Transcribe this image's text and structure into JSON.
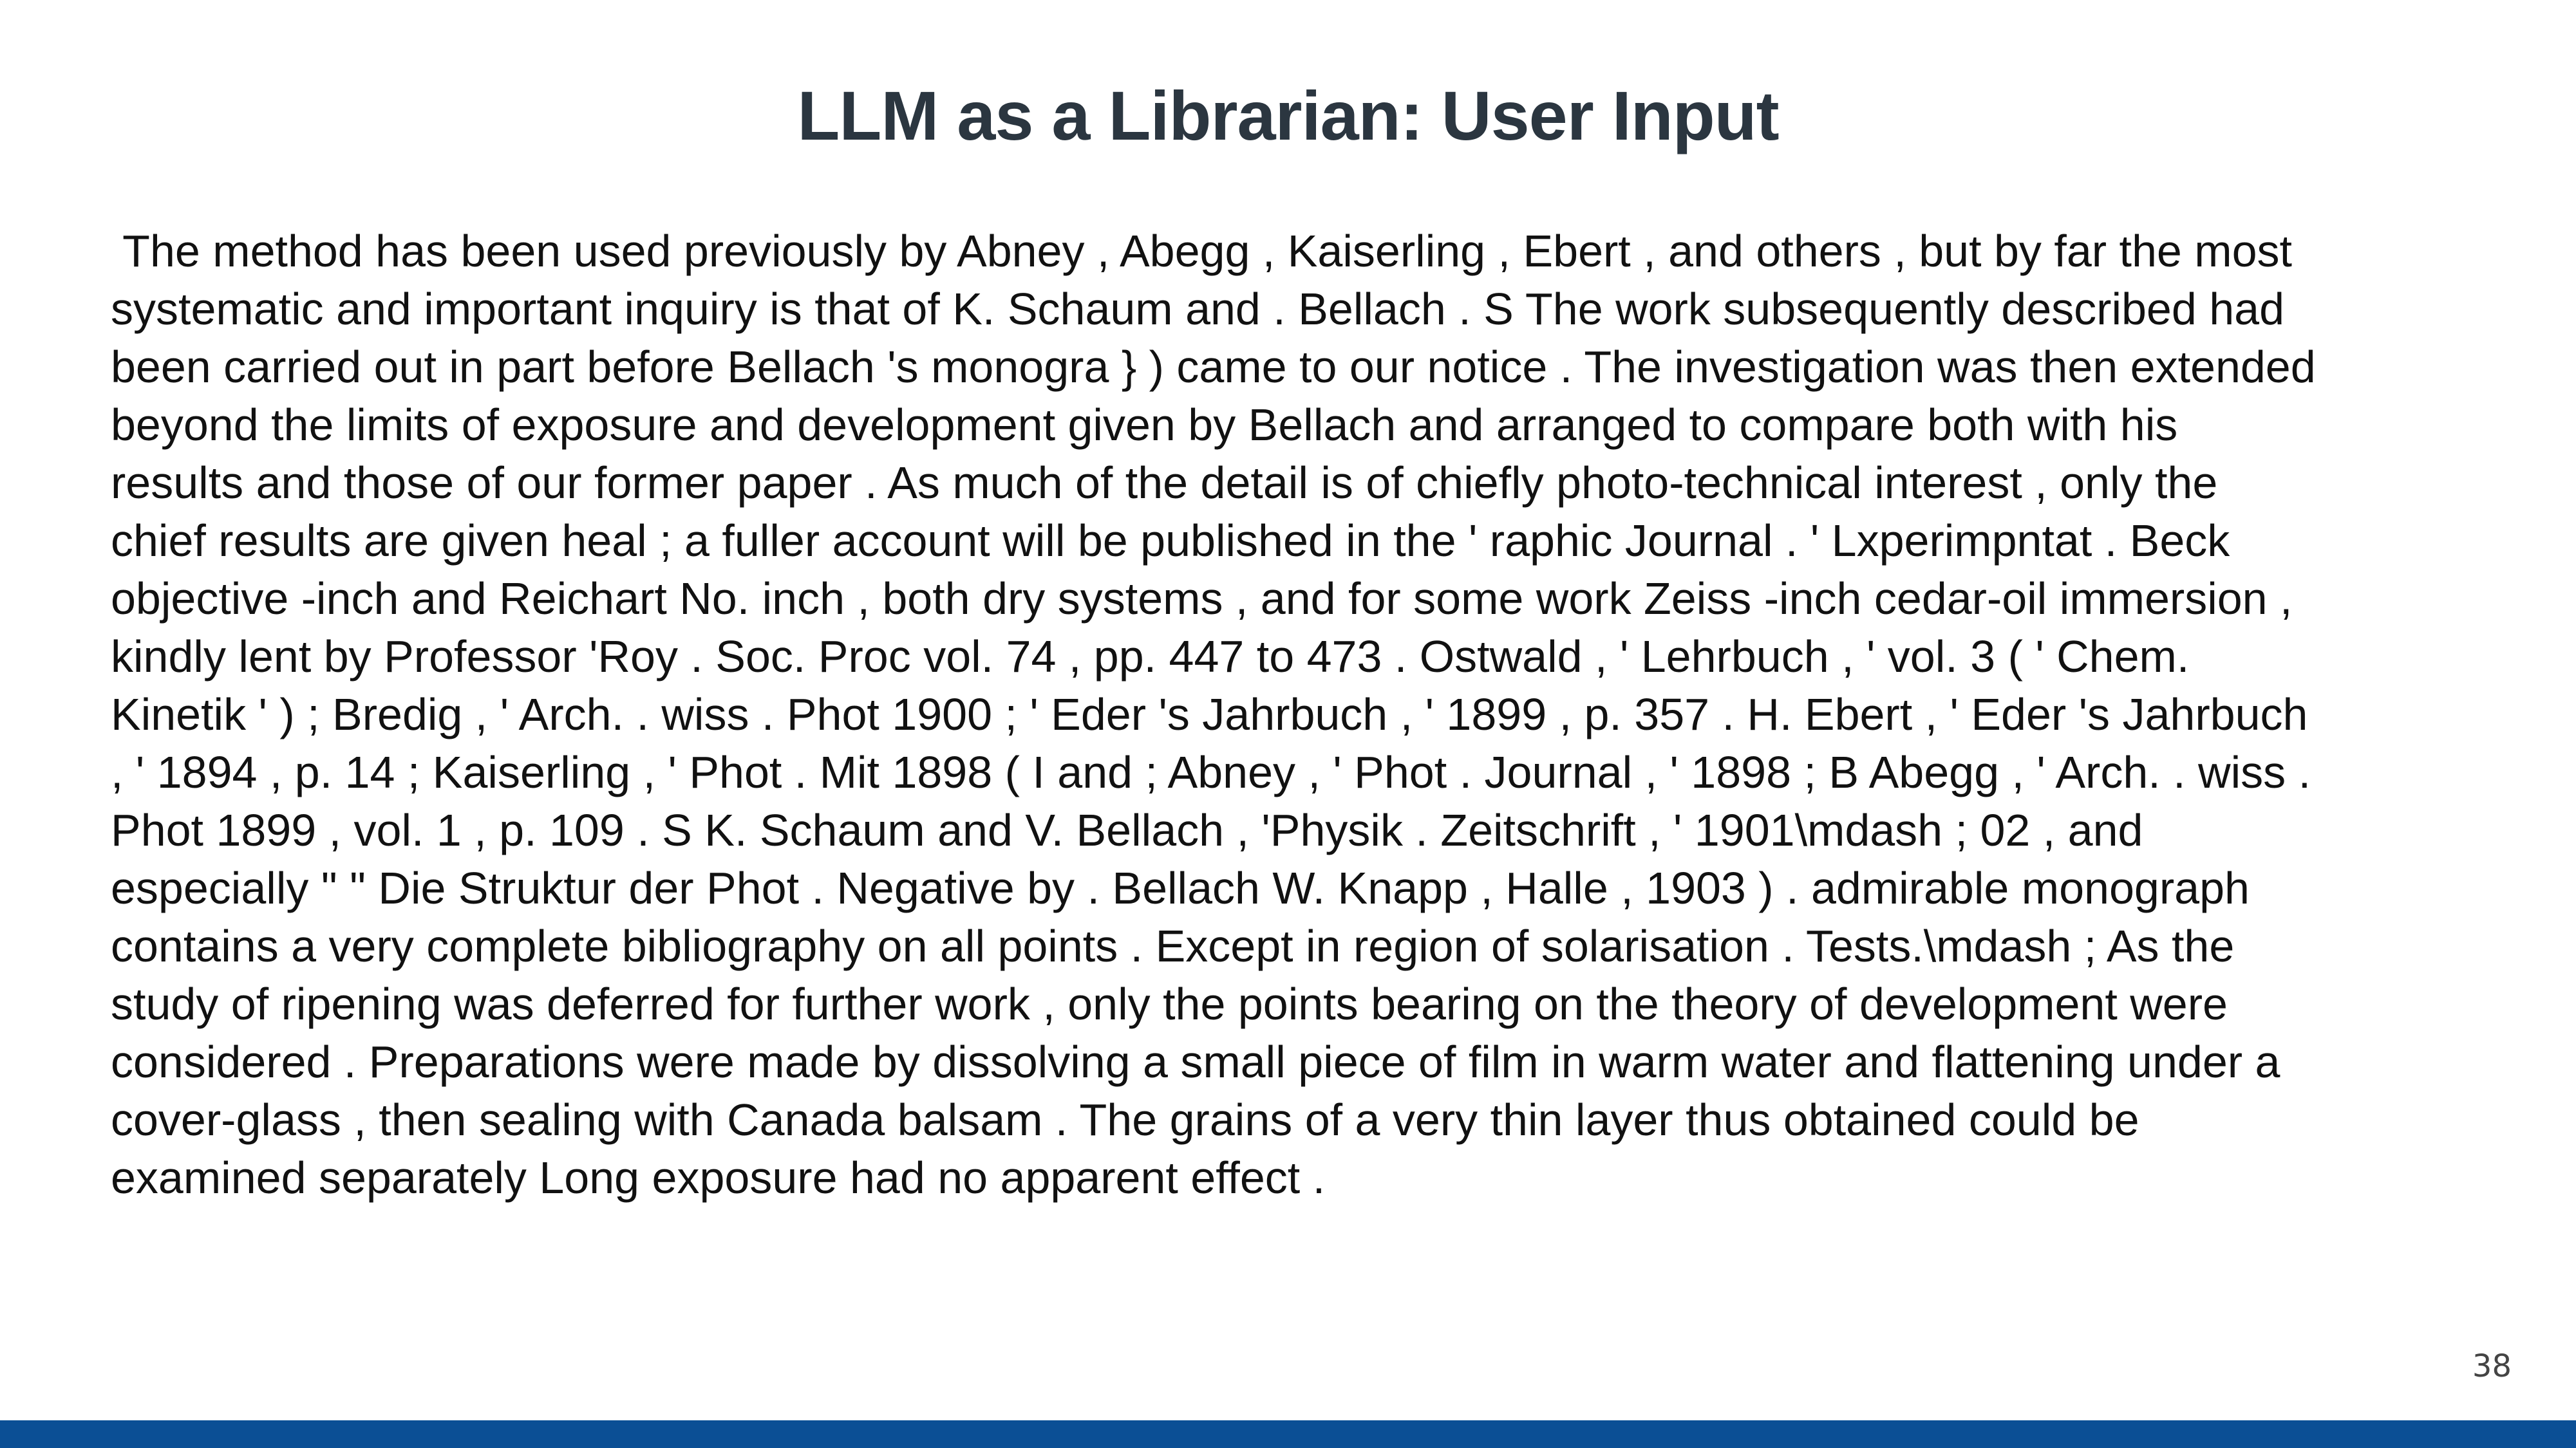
{
  "slide": {
    "title": "LLM as a Librarian: User Input",
    "body_lines": [
      " The method has been used previously by Abney , Abegg , Kaiserling , Ebert , and others , but by far the most",
      "systematic and important inquiry is that of K. Schaum and . Bellach . S The work subsequently described had",
      "been carried out in part before Bellach 's monogra } ) came to our notice . The investigation was then extended",
      "beyond the limits of exposure and development given by Bellach and arranged to compare both with his",
      "results and those of our former paper . As much of the detail is of chiefly photo-technical interest , only the",
      "chief results are given heal ; a fuller account will be published in the ' raphic Journal . ' Lxperimpntat . Beck",
      "objective -inch and Reichart No. inch , both dry systems , and for some work Zeiss -inch cedar-oil immersion ,",
      "kindly lent by Professor 'Roy . Soc. Proc vol. 74 , pp. 447 to 473 . Ostwald , ' Lehrbuch , ' vol. 3 ( ' Chem.",
      "Kinetik ' ) ; Bredig , ' Arch. . wiss . Phot 1900 ; ' Eder 's Jahrbuch , ' 1899 , p. 357 . H. Ebert , ' Eder 's Jahrbuch",
      ", ' 1894 , p. 14 ; Kaiserling , ' Phot . Mit 1898 ( I and ; Abney , ' Phot . Journal , ' 1898 ; B Abegg , ' Arch. . wiss .",
      "Phot 1899 , vol. 1 , p. 109 . S K. Schaum and V. Bellach , 'Physik . Zeitschrift , ' 1901\\mdash ; 02 , and",
      "especially \" \" Die Struktur der Phot . Negative by . Bellach W. Knapp , Halle , 1903 ) . admirable monograph",
      "contains a very complete bibliography on all points . Except in region of solarisation . Tests.\\mdash ; As the",
      "study of ripening was deferred for further work , only the points bearing on the theory of development were",
      "considered . Preparations were made by dissolving a small piece of film in warm water and flattening under a",
      "cover-glass , then sealing with Canada balsam . The grains of a very thin layer thus obtained could be",
      "examined separately Long exposure had no apparent effect ."
    ],
    "page_number": "38",
    "colors": {
      "title": "#2b3640",
      "footer_bar": "#0b4f95"
    }
  }
}
